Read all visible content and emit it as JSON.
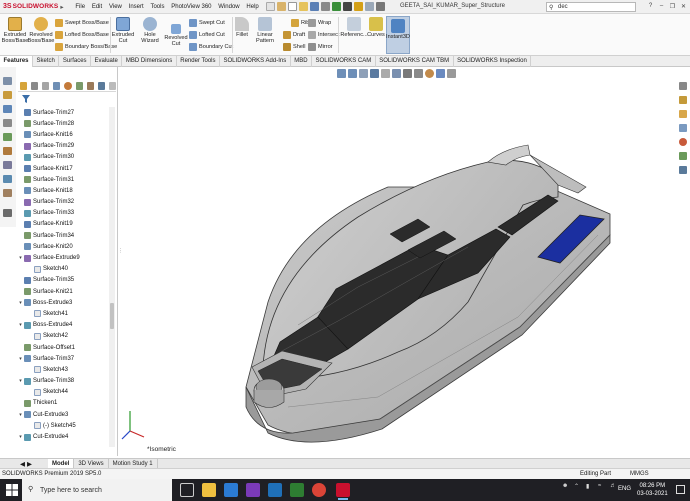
{
  "app": {
    "logo_prefix": "3S",
    "logo_text": "SOLIDWORKS",
    "document_title": "GEETA_SAI_KUMAR_Super_Structure",
    "menu": [
      "File",
      "Edit",
      "View",
      "Insert",
      "Tools",
      "PhotoView 360",
      "Window",
      "Help"
    ]
  },
  "search": {
    "value": "dec"
  },
  "ribbon": {
    "extruded_boss": "Extruded\nBoss/Base",
    "revolved_boss": "Revolved\nBoss/Base",
    "swept_boss": "Swept Boss/Base",
    "lofted_boss": "Lofted Boss/Base",
    "boundary_boss": "Boundary Boss/Base",
    "extruded_cut": "Extruded\nCut",
    "hole_wizard": "Hole Wizard",
    "revolved_cut": "Revolved\nCut",
    "swept_cut": "Swept Cut",
    "lofted_cut": "Lofted Cut",
    "boundary_cut": "Boundary Cut",
    "fillet": "Fillet",
    "linear_pattern": "Linear Pattern",
    "rib": "Rib",
    "draft": "Draft",
    "shell": "Shell",
    "wrap": "Wrap",
    "intersect": "Intersect",
    "mirror": "Mirror",
    "reference": "Referenc...",
    "curves": "Curves",
    "instant3d": "Instant3D"
  },
  "command_tabs": [
    "Features",
    "Sketch",
    "Surfaces",
    "Evaluate",
    "MBD Dimensions",
    "Render Tools",
    "SOLIDWORKS Add-Ins",
    "MBD",
    "SOLIDWORKS CAM",
    "SOLIDWORKS CAM TBM",
    "SOLIDWORKS Inspection"
  ],
  "feature_tree": [
    {
      "label": "Surface-Trim27",
      "expandable": false,
      "child": false
    },
    {
      "label": "Surface-Trim28",
      "expandable": false,
      "child": false
    },
    {
      "label": "Surface-Knit16",
      "expandable": false,
      "child": false
    },
    {
      "label": "Surface-Trim29",
      "expandable": false,
      "child": false
    },
    {
      "label": "Surface-Trim30",
      "expandable": false,
      "child": false
    },
    {
      "label": "Surface-Knit17",
      "expandable": false,
      "child": false
    },
    {
      "label": "Surface-Trim31",
      "expandable": false,
      "child": false
    },
    {
      "label": "Surface-Knit18",
      "expandable": false,
      "child": false
    },
    {
      "label": "Surface-Trim32",
      "expandable": false,
      "child": false
    },
    {
      "label": "Surface-Trim33",
      "expandable": false,
      "child": false
    },
    {
      "label": "Surface-Knit19",
      "expandable": false,
      "child": false
    },
    {
      "label": "Surface-Trim34",
      "expandable": false,
      "child": false
    },
    {
      "label": "Surface-Knit20",
      "expandable": false,
      "child": false
    },
    {
      "label": "Surface-Extrude9",
      "expandable": true,
      "child": false
    },
    {
      "label": "Sketch40",
      "expandable": false,
      "child": true
    },
    {
      "label": "Surface-Trim35",
      "expandable": false,
      "child": false
    },
    {
      "label": "Surface-Knit21",
      "expandable": false,
      "child": false
    },
    {
      "label": "Boss-Extrude3",
      "expandable": true,
      "child": false
    },
    {
      "label": "Sketch41",
      "expandable": false,
      "child": true
    },
    {
      "label": "Boss-Extrude4",
      "expandable": true,
      "child": false
    },
    {
      "label": "Sketch42",
      "expandable": false,
      "child": true
    },
    {
      "label": "Surface-Offset1",
      "expandable": false,
      "child": false
    },
    {
      "label": "Surface-Trim37",
      "expandable": true,
      "child": false
    },
    {
      "label": "Sketch43",
      "expandable": false,
      "child": true
    },
    {
      "label": "Surface-Trim38",
      "expandable": true,
      "child": false
    },
    {
      "label": "Sketch44",
      "expandable": false,
      "child": true
    },
    {
      "label": "Thicken1",
      "expandable": false,
      "child": false
    },
    {
      "label": "Cut-Extrude3",
      "expandable": true,
      "child": false
    },
    {
      "label": "(-) Sketch45",
      "expandable": false,
      "child": true
    },
    {
      "label": "Cut-Extrude4",
      "expandable": true,
      "child": false
    }
  ],
  "viewport": {
    "view_label": "*Isometric"
  },
  "bottom_tabs": [
    "Model",
    "3D Views",
    "Motion Study 1"
  ],
  "status": {
    "product": "SOLIDWORKS Premium 2019 SP5.0",
    "mode": "Editing Part",
    "units": "MMGS"
  },
  "taskbar": {
    "search_placeholder": "Type here to search",
    "language": "ENG",
    "time": "08:26 PM",
    "date": "03-03-2021"
  },
  "colors": {
    "accent": "#c8102e",
    "hull": "#b7b7b7",
    "window": "#2b2b2b",
    "deck_pool": "#1b2fa0",
    "taskbar": "#1f1f24"
  }
}
